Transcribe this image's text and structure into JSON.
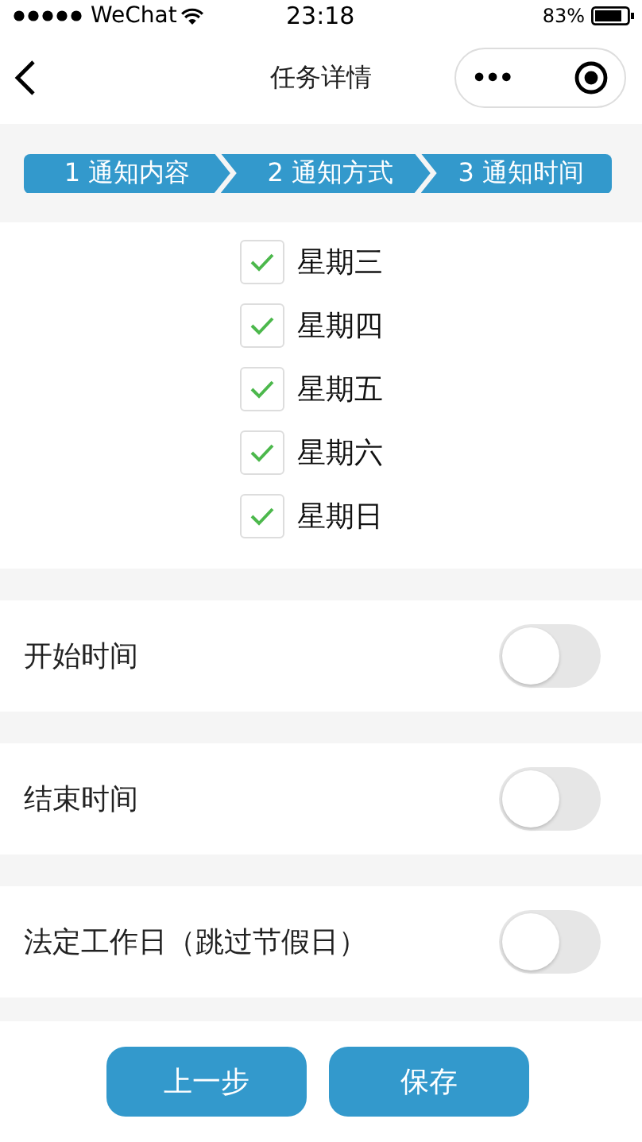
{
  "status_bar": {
    "carrier": "WeChat",
    "time": "23:18",
    "battery": "83%"
  },
  "nav_bar": {
    "title": "任务详情",
    "menu": "•••"
  },
  "steps": [
    {
      "label": "1 通知内容"
    },
    {
      "label": "2 通知方式"
    },
    {
      "label": "3 通知时间"
    }
  ],
  "weekdays": [
    {
      "label": "星期三",
      "checked": true
    },
    {
      "label": "星期四",
      "checked": true
    },
    {
      "label": "星期五",
      "checked": true
    },
    {
      "label": "星期六",
      "checked": true
    },
    {
      "label": "星期日",
      "checked": true
    }
  ],
  "settings": [
    {
      "label": "开始时间",
      "on": false
    },
    {
      "label": "结束时间",
      "on": false
    },
    {
      "label": "法定工作日（跳过节假日）",
      "on": false
    }
  ],
  "buttons": [
    {
      "label": "上一步"
    },
    {
      "label": "保存"
    }
  ]
}
